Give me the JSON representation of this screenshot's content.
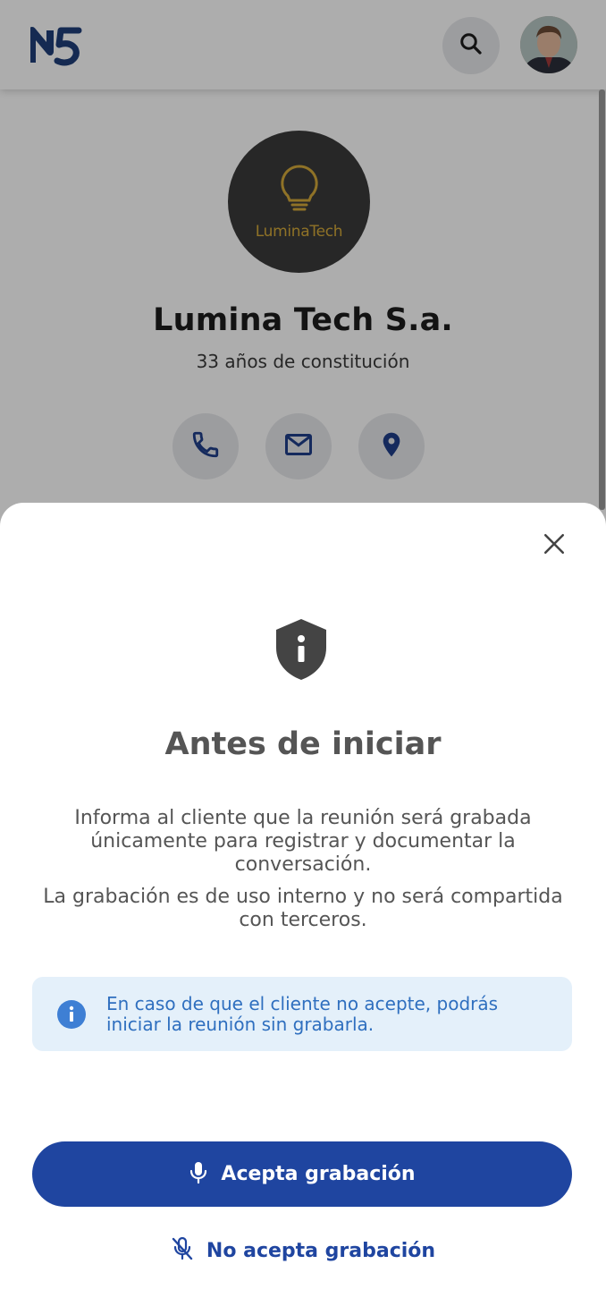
{
  "header": {
    "logo_text": "N5",
    "search_icon": "search-icon",
    "avatar_icon": "user-avatar"
  },
  "company": {
    "logo_text": "LuminaTech",
    "name": "Lumina Tech S.a.",
    "subtitle": "33 años de constitución",
    "actions": [
      "phone-icon",
      "mail-icon",
      "location-icon"
    ]
  },
  "modal": {
    "close_icon": "close-icon",
    "icon": "shield-info-icon",
    "title": "Antes de iniciar",
    "paragraph1": "Informa al cliente que la reunión será grabada únicamente para registrar y documentar la conversación.",
    "paragraph2": "La grabación es de uso interno y no será compartida con terceros.",
    "info_text": "En caso de que el cliente no acepte, podrás iniciar la reunión sin grabarla.",
    "accept_label": "Acepta grabación",
    "decline_label": "No acepta grabación"
  },
  "colors": {
    "primary": "#1f45a0",
    "info_background": "#e4f0fa",
    "info_text": "#2f6fbf",
    "logo_accent": "#d3a93a"
  }
}
